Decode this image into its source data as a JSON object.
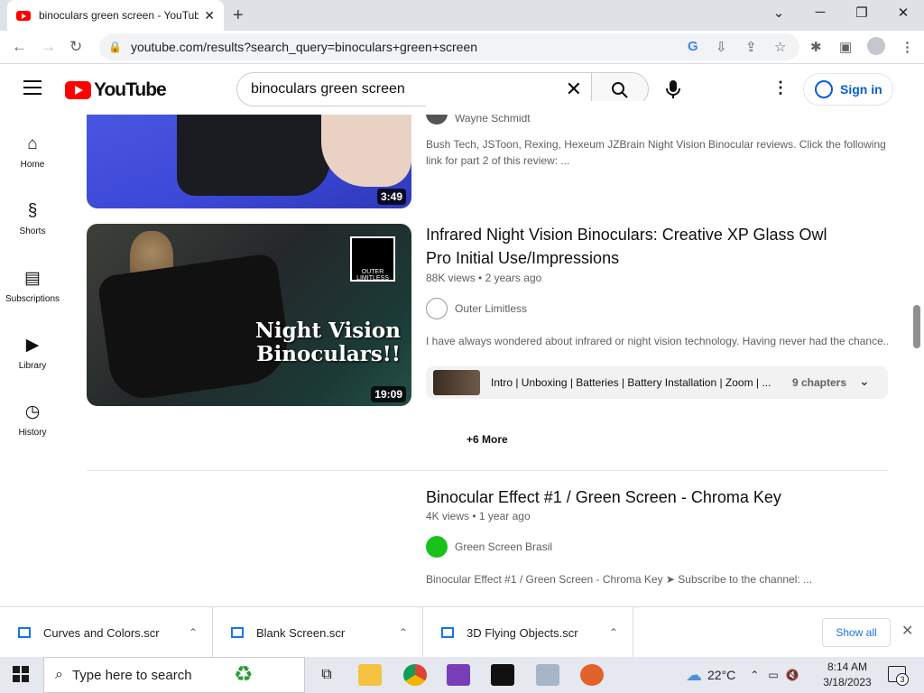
{
  "browser": {
    "tab_title": "binoculars green screen - YouTube",
    "url": "youtube.com/results?search_query=binoculars+green+screen"
  },
  "youtube": {
    "logo_text": "YouTube",
    "search_value": "binoculars green screen",
    "sign_in": "Sign in",
    "sidebar": [
      {
        "label": "Home",
        "icon": "home-icon"
      },
      {
        "label": "Shorts",
        "icon": "shorts-icon"
      },
      {
        "label": "Subscriptions",
        "icon": "subscriptions-icon"
      },
      {
        "label": "Library",
        "icon": "library-icon"
      },
      {
        "label": "History",
        "icon": "history-icon"
      }
    ]
  },
  "results": [
    {
      "duration": "3:49",
      "channel": "Wayne Schmidt",
      "description": "Bush Tech, JSToon, Rexing, Hexeum JZBrain Night Vision Binocular reviews. Click the following link for part 2 of this review: ..."
    },
    {
      "title": "Infrared Night Vision Binoculars: Creative XP Glass Owl Pro Initial Use/Impressions",
      "views": "88K views",
      "age": "2 years ago",
      "channel": "Outer Limitless",
      "description": "I have always wondered about infrared or night vision technology. Having never had the chance...",
      "duration": "19:09",
      "thumb_text": "Night Vision Binoculars!!",
      "thumb_badge": "OUTER LIMITLESS",
      "chapters_text": "Intro | Unboxing | Batteries | Battery Installation | Zoom | ...",
      "chapters_count": "9 chapters",
      "more": "+6 More"
    },
    {
      "title": "Binocular Effect #1 / Green Screen - Chroma Key",
      "views": "4K views",
      "age": "1 year ago",
      "channel": "Green Screen Brasil",
      "description": "Binocular Effect #1 / Green Screen - Chroma Key ➤ Subscribe to the channel: ..."
    }
  ],
  "downloads": {
    "items": [
      "Curves and Colors.scr",
      "Blank Screen.scr",
      "3D Flying Objects.scr"
    ],
    "show_all": "Show all"
  },
  "taskbar": {
    "search_placeholder": "Type here to search",
    "temperature": "22°C",
    "time": "8:14 AM",
    "date": "3/18/2023",
    "notifications": "3"
  }
}
